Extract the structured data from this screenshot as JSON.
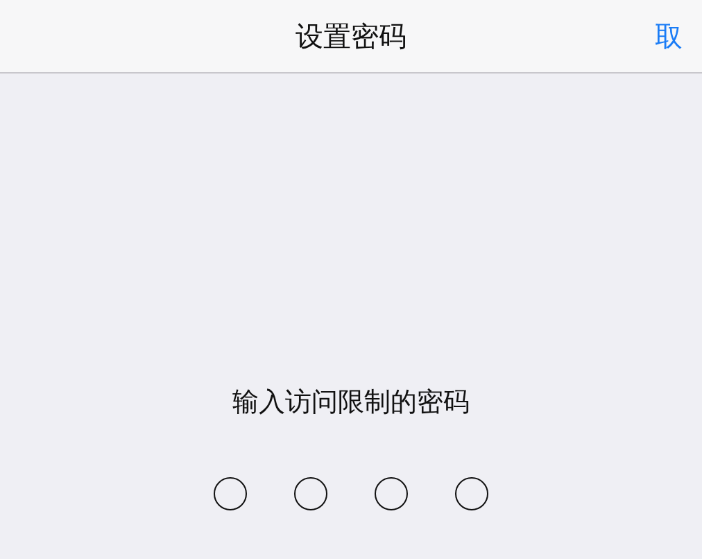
{
  "nav_bar": {
    "title": "设置密码",
    "cancel": "取"
  },
  "prompt": "输入访问限制的密码",
  "passcode_dots": [
    {
      "filled": false
    },
    {
      "filled": false
    },
    {
      "filled": false
    },
    {
      "filled": false
    }
  ]
}
